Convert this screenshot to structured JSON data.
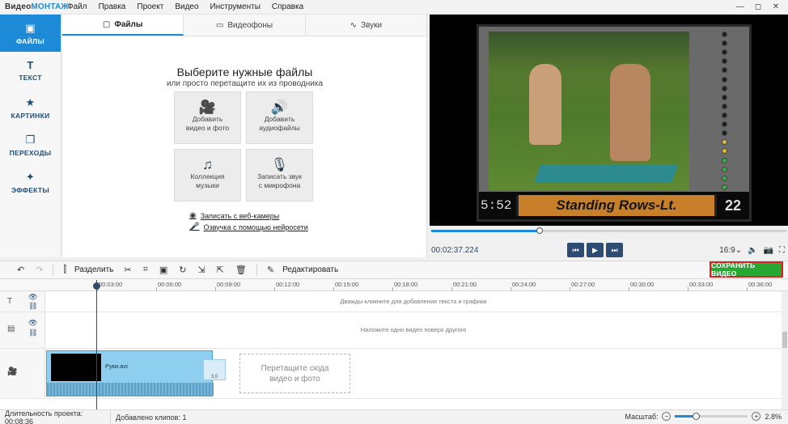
{
  "app": {
    "logo_plain": "Видео",
    "logo_accent": "МОНТАЖ"
  },
  "menu": [
    "Файл",
    "Правка",
    "Проект",
    "Видео",
    "Инструменты",
    "Справка"
  ],
  "window_buttons": {
    "minimize": "—",
    "maximize": "◻",
    "close": "✕"
  },
  "sidebar": [
    {
      "label": "ФАЙЛЫ",
      "icon": "folder-icon",
      "glyph": "▣"
    },
    {
      "label": "ТЕКСТ",
      "icon": "text-icon",
      "glyph": "T"
    },
    {
      "label": "КАРТИНКИ",
      "icon": "star-icon",
      "glyph": "★"
    },
    {
      "label": "ПЕРЕХОДЫ",
      "icon": "transitions-icon",
      "glyph": "❐"
    },
    {
      "label": "ЭФФЕКТЫ",
      "icon": "magic-wand-icon",
      "glyph": "✦"
    }
  ],
  "tabs": [
    {
      "label": "Файлы",
      "glyph": "▢"
    },
    {
      "label": "Видеофоны",
      "glyph": "▭"
    },
    {
      "label": "Звуки",
      "glyph": "∿"
    }
  ],
  "files_panel": {
    "title": "Выберите нужные файлы",
    "subtitle": "или просто перетащите их из проводника",
    "tiles": [
      {
        "line1": "Добавить",
        "line2": "видео и фото",
        "icon": "camera-icon",
        "glyph": "🎥"
      },
      {
        "line1": "Добавить",
        "line2": "аудиофайлы",
        "icon": "audio-file-icon",
        "glyph": "🔊"
      },
      {
        "line1": "Коллекция",
        "line2": "музыки",
        "icon": "music-note-icon",
        "glyph": "♫"
      },
      {
        "line1": "Записать звук",
        "line2": "с микрофона",
        "icon": "microphone-icon",
        "glyph": "🎙"
      }
    ],
    "links": [
      {
        "label": "Записать с веб-камеры",
        "icon": "webcam-icon",
        "glyph": "◉"
      },
      {
        "label": "Озвучка с помощью нейросети",
        "icon": "voice-icon",
        "glyph": "🎤"
      }
    ]
  },
  "preview": {
    "caption_time": "5:52",
    "caption_title": "Standing Rows-Lt.",
    "caption_number": "22",
    "progress": 0.305,
    "timecode": "00:02:37.224",
    "aspect": "16:9",
    "aspect_arrow": "⌄",
    "buttons": {
      "prev": "⏮",
      "play": "▶",
      "next": "⏭"
    },
    "right_icons": {
      "volume": "🔈",
      "snapshot": "📷",
      "fullscreen": "⛶"
    }
  },
  "toolbar": {
    "split_label": "Разделить",
    "edit_label": "Редактировать",
    "save_label": "СОХРАНИТЬ ВИДЕО",
    "glyphs": {
      "undo": "↶",
      "redo": "↷",
      "split": "⫿",
      "cut": "✂",
      "crop": "⌗",
      "frame": "▣",
      "rotate": "↻",
      "export": "⇲",
      "insert": "⇱",
      "delete": "🗑",
      "edit": "✎"
    }
  },
  "timeline": {
    "ticks": [
      "00:03:00",
      "00:06:00",
      "00:09:00",
      "00:12:00",
      "00:15:00",
      "00:18:00",
      "00:21:00",
      "00:24:00",
      "00:27:00",
      "00:30:00",
      "00:33:00",
      "00:36:00"
    ],
    "text_track_hint": "Дважды кликните для добавления текста и графики",
    "overlay_track_hint": "Наложите одно видео поверх другого",
    "clip_name": "Руки.avi",
    "clip_ghost_label": "3,0",
    "drop_line1": "Перетащите сюда",
    "drop_line2": "видео и фото",
    "head_glyphs": {
      "text": "T",
      "overlay": "▤",
      "video": "🎥",
      "eye": "👁",
      "link": "⛓"
    }
  },
  "status": {
    "duration_label": "Длительность проекта:",
    "duration_value": "00:08:36",
    "clips_label": "Добавлено клипов:",
    "clips_value": "1",
    "zoom_label": "Масштаб:",
    "zoom_value": "2.8%",
    "zoom_level": 0.28,
    "zoom_minus": "−",
    "zoom_plus": "+"
  }
}
